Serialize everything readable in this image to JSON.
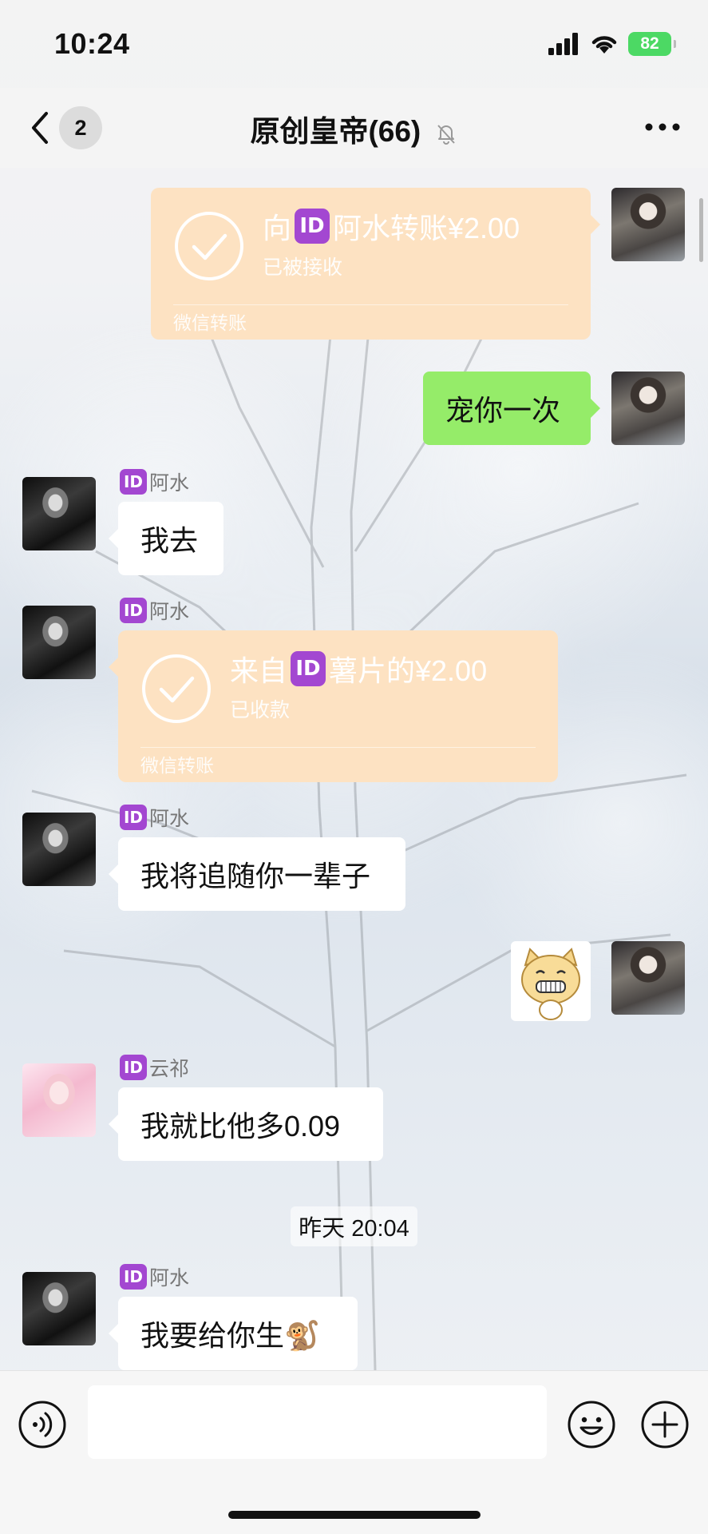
{
  "status_bar": {
    "time": "10:24",
    "battery": "82"
  },
  "nav": {
    "unread_count": "2",
    "title": "原创皇帝(66)"
  },
  "messages": {
    "m1": {
      "amount_prefix": "向",
      "id_badge": "ID",
      "amount_text": "阿水转账¥2.00",
      "status": "已被接收",
      "footer": "微信转账"
    },
    "m2": {
      "text": "宠你一次"
    },
    "m3": {
      "sender": "阿水",
      "id_badge": "ID",
      "text": "我去"
    },
    "m4": {
      "sender": "阿水",
      "id_badge": "ID",
      "amount_prefix": "来自",
      "amount_badge": "ID",
      "amount_text": "薯片的¥2.00",
      "status": "已收款",
      "footer": "微信转账"
    },
    "m5": {
      "sender": "阿水",
      "id_badge": "ID",
      "text": "我将追随你一辈子"
    },
    "m6": {
      "sticker": "cat-grin-sticker"
    },
    "m7": {
      "sender": "云祁",
      "id_badge": "ID",
      "text": "我就比他多0.09"
    },
    "divider": {
      "time": "昨天 20:04"
    },
    "m8": {
      "sender": "阿水",
      "id_badge": "ID",
      "text": "我要给你生🐒"
    }
  },
  "colors": {
    "green_bubble": "#95ec69",
    "transfer_bubble": "#fde2c2",
    "id_badge": "#a347d1",
    "battery": "#4cd964"
  },
  "icons": [
    "back-icon",
    "mute-icon",
    "more-icon",
    "check-icon",
    "voice-icon",
    "emoji-icon",
    "plus-icon",
    "signal-icon",
    "wifi-icon"
  ]
}
